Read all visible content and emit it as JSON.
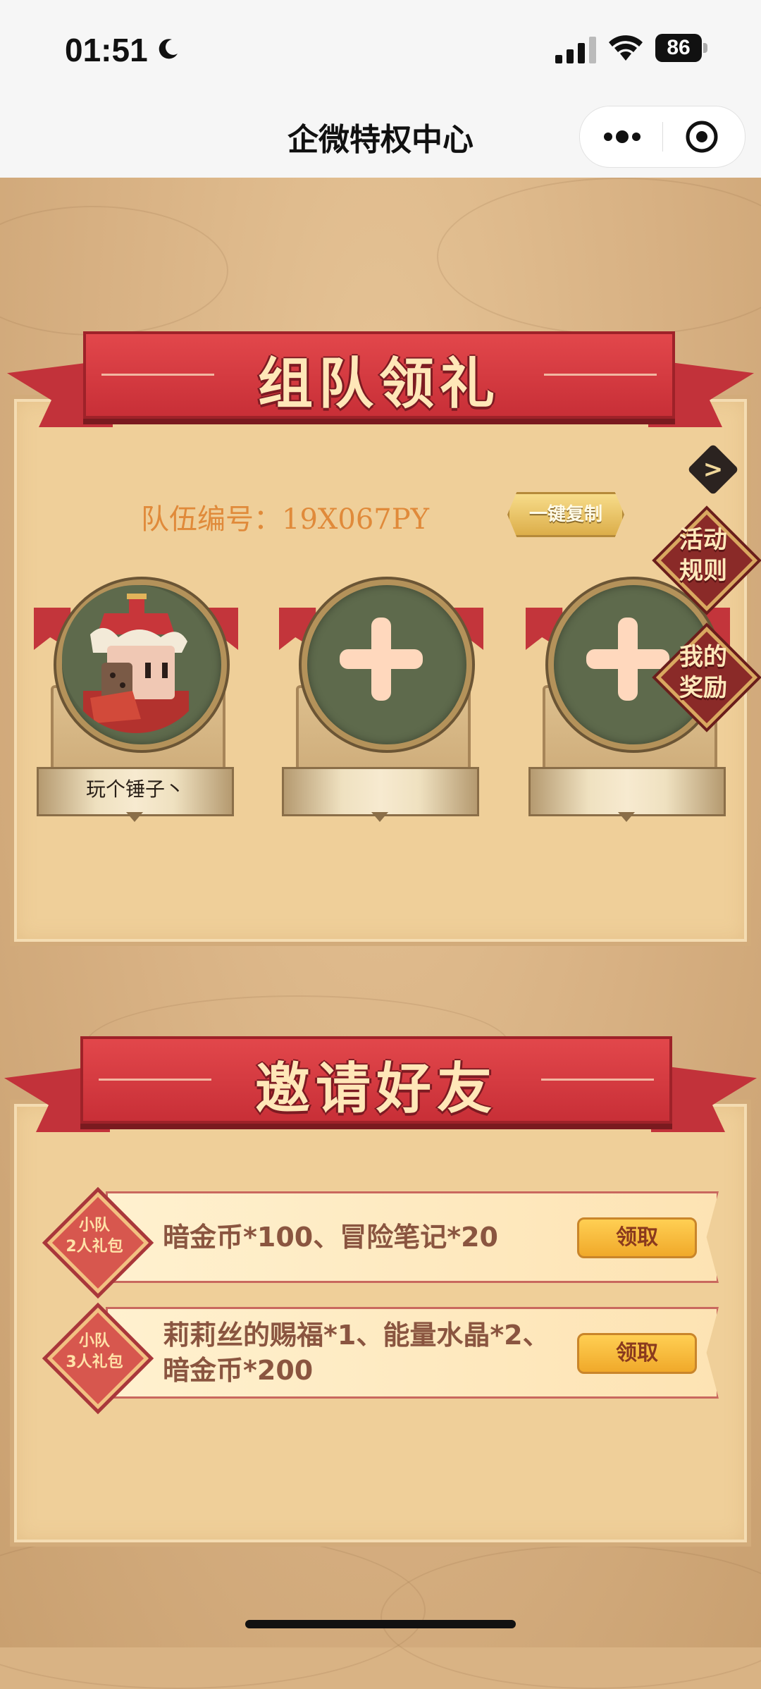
{
  "status_bar": {
    "time": "01:51",
    "battery": "86"
  },
  "navbar": {
    "title": "企微特权中心"
  },
  "team_section": {
    "banner": "组队领礼",
    "team_id": "队伍编号：19X067PY",
    "copy_button": "一键复制",
    "members": [
      {
        "name": "玩个锤子丶",
        "filled": true
      },
      {
        "name": "",
        "filled": false
      },
      {
        "name": "",
        "filled": false
      }
    ]
  },
  "side_badges": {
    "rules": "活动\n规则",
    "rewards": "我的\n奖励"
  },
  "invite_section": {
    "banner": "邀请好友",
    "gifts": [
      {
        "badge": "小队\n2人礼包",
        "text": "暗金币*100、冒险笔记*20",
        "button": "领取"
      },
      {
        "badge": "小队\n3人礼包",
        "text": "莉莉丝的赐福*1、能量水晶*2、暗金币*200",
        "button": "领取"
      }
    ]
  },
  "colors": {
    "ribbon": "#c82f37",
    "panel": "#efcf99",
    "team_id": "#e08a3a",
    "claim": "#f0a92a"
  }
}
